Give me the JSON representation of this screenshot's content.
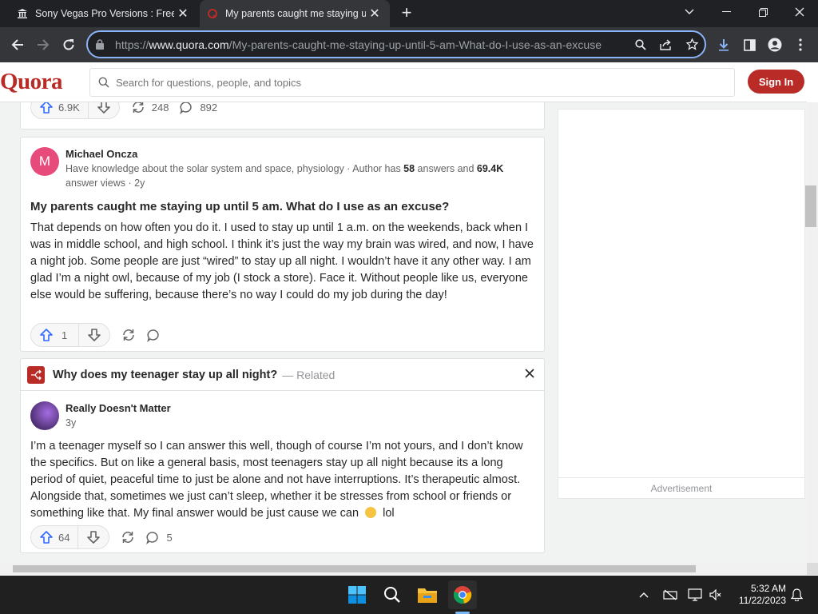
{
  "browser": {
    "tabs": [
      {
        "title": "Sony Vegas Pro Versions : Free Do",
        "active": false
      },
      {
        "title": "My parents caught me staying up",
        "active": true
      }
    ],
    "url_prefix": "https://",
    "url_host": "www.quora.com",
    "url_path": "/My-parents-caught-me-staying-up-until-5-am-What-do-I-use-as-an-excuse"
  },
  "quora": {
    "logo": "Quora",
    "search_placeholder": "Search for questions, people, and topics",
    "signin_label": "Sign In"
  },
  "prev_answer_actions": {
    "upvotes": "6.9K",
    "shares": "248",
    "comments": "892"
  },
  "answer1": {
    "avatar_letter": "M",
    "author": "Michael Oncza",
    "cred_prefix": "Have knowledge about the solar system and space, physiology · Author has ",
    "answers_count": "58",
    "cred_mid": " answers and ",
    "views_count": "69.4K",
    "cred_suffix": "answer views · 2y",
    "question": "My parents caught me staying up until 5 am. What do I use as an excuse?",
    "text": "That depends on how often you do it. I used to stay up until 1 a.m. on the weekends, back when I was in middle school, and high school. I think it’s just the way my brain was wired, and now, I have a night job. Some people are just “wired” to stay up all night. I wouldn’t have it any other way. I am glad I’m a night owl, because of my job (I stock a store). Face it. Without people like us, everyone else would be suffering, because there’s no way I could do my job during the day!",
    "upvotes": "1"
  },
  "related": {
    "title": "Why does my teenager stay up all night?",
    "tag": "— Related",
    "author": "Really Doesn't Matter",
    "age": "3y",
    "text": "I’m a teenager myself so I can answer this well, though of course I’m not yours, and I don’t know the specifics. But on like a general basis, most teenagers stay up all night because its a long period of quiet, peaceful time to just be alone and not have interruptions. It’s therapeutic almost. Alongside that, sometimes we just can’t sleep, whether it be stresses from school or friends or something like that. My final answer would be just cause we can",
    "text_tail": "lol",
    "upvotes": "64",
    "comments": "5"
  },
  "sidebar": {
    "ad_label": "Advertisement"
  },
  "taskbar": {
    "time": "5:32 AM",
    "date": "11/22/2023"
  },
  "colors": {
    "brand": "#b92b27",
    "accent": "#8ab4f8",
    "upvote": "#2e69ff"
  }
}
